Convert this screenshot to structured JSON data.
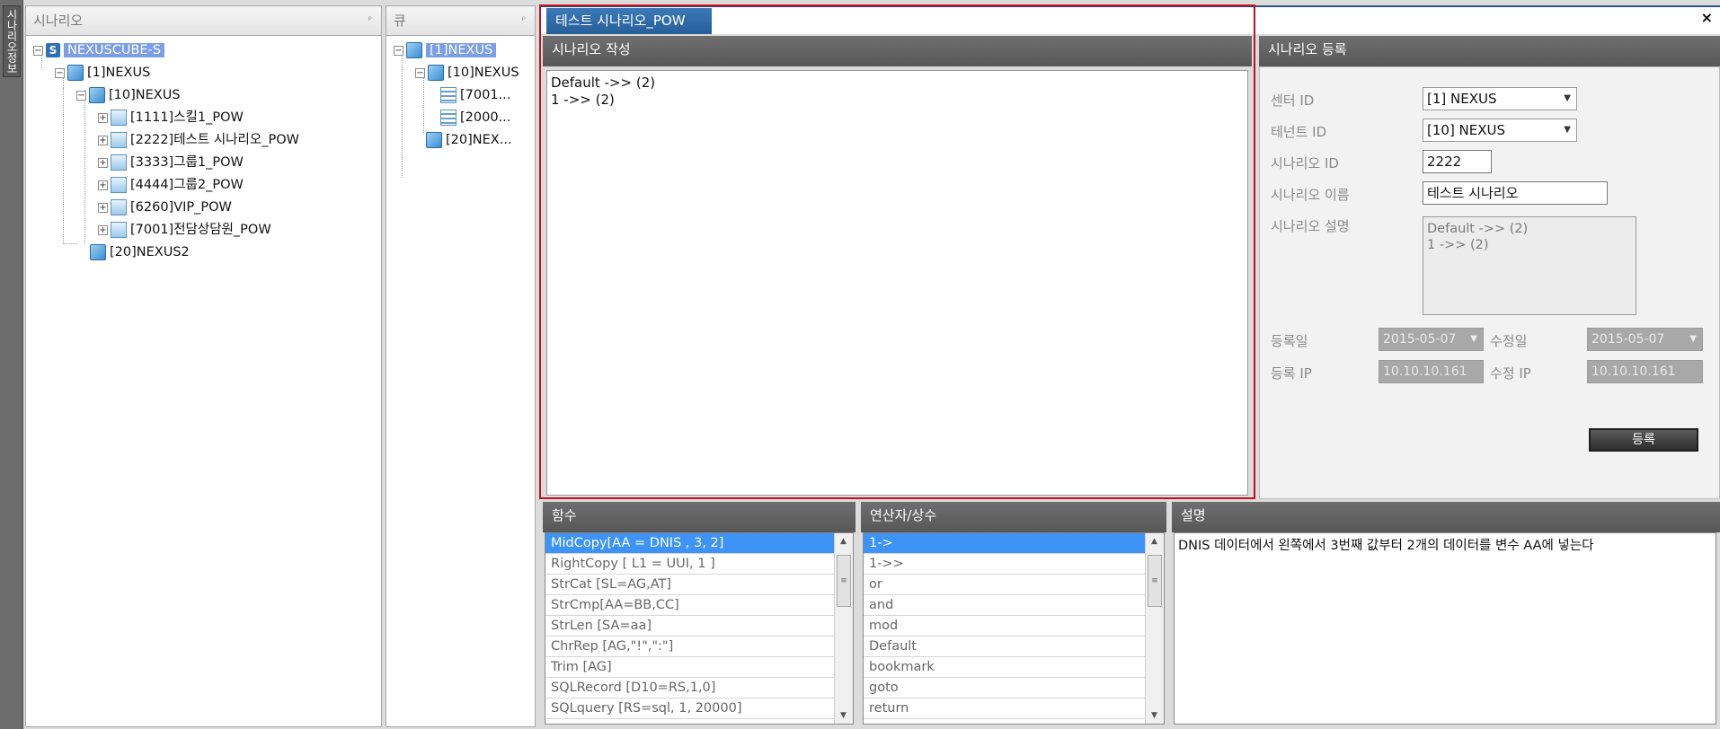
{
  "sidebar_strip": {
    "label": "시나리오정보"
  },
  "scenario_panel": {
    "title": "시나리오",
    "tree": [
      {
        "label": "NEXUSCUBE-S",
        "selected": true
      },
      {
        "label": "[1]NEXUS"
      },
      {
        "label": "[10]NEXUS"
      },
      {
        "label": "[1111]스킬1_POW"
      },
      {
        "label": "[2222]테스트 시나리오_POW"
      },
      {
        "label": "[3333]그룹1_POW"
      },
      {
        "label": "[4444]그룹2_POW"
      },
      {
        "label": "[6260]VIP_POW"
      },
      {
        "label": "[7001]전담상담원_POW"
      },
      {
        "label": "[20]NEXUS2"
      }
    ]
  },
  "queue_panel": {
    "title": "큐",
    "tree": [
      {
        "label": "[1]NEXUS",
        "selected": true
      },
      {
        "label": "[10]NEXUS"
      },
      {
        "label": "[7001..."
      },
      {
        "label": "[2000..."
      },
      {
        "label": "[20]NEX..."
      }
    ]
  },
  "tab": {
    "label": "테스트 시나리오_POW",
    "close": "×"
  },
  "editor": {
    "title": "시나리오 작성",
    "content": "Default ->> (2)\n1 ->> (2)"
  },
  "register": {
    "title": "시나리오 등록",
    "center_label": "센터 ID",
    "center_value": "[1] NEXUS",
    "tenant_label": "테넌트 ID",
    "tenant_value": "[10] NEXUS",
    "scenario_id_label": "시나리오 ID",
    "scenario_id_value": "2222",
    "scenario_name_label": "시나리오 이름",
    "scenario_name_value": "테스트 시나리오",
    "scenario_desc_label": "시나리오 설명",
    "scenario_desc_value": "Default ->> (2)\n1 ->> (2)",
    "reg_date_label": "등록일",
    "reg_date_value": "2015-05-07",
    "mod_date_label": "수정일",
    "mod_date_value": "2015-05-07",
    "reg_ip_label": "등록 IP",
    "reg_ip_value": "10.10.10.161",
    "mod_ip_label": "수정 IP",
    "mod_ip_value": "10.10.10.161",
    "button": "등록"
  },
  "functions": {
    "title": "함수",
    "items": [
      "MidCopy[AA = DNIS , 3, 2]",
      "RightCopy [ L1 = UUI, 1 ]",
      "StrCat [SL=AG,AT]",
      "StrCmp[AA=BB,CC]",
      "StrLen [SA=aa]",
      "ChrRep [AG,\"!\",\":\"]",
      "Trim [AG]",
      "SQLRecord [D10=RS,1,0]",
      "SQLquery [RS=sql, 1, 20000]"
    ]
  },
  "operators": {
    "title": "연산자/상수",
    "items": [
      "1->",
      "1->>",
      "or",
      "and",
      "mod",
      "Default",
      "bookmark",
      "goto",
      "return"
    ]
  },
  "description": {
    "title": "설명",
    "text": "DNIS 데이터에서 왼쪽에서 3번째 값부터 2개의 데이터를 변수 AA에 넣는다"
  },
  "colors": {
    "tab": "#2f6aa6",
    "selection": "#3d94f6",
    "frame": "#c0111f"
  }
}
